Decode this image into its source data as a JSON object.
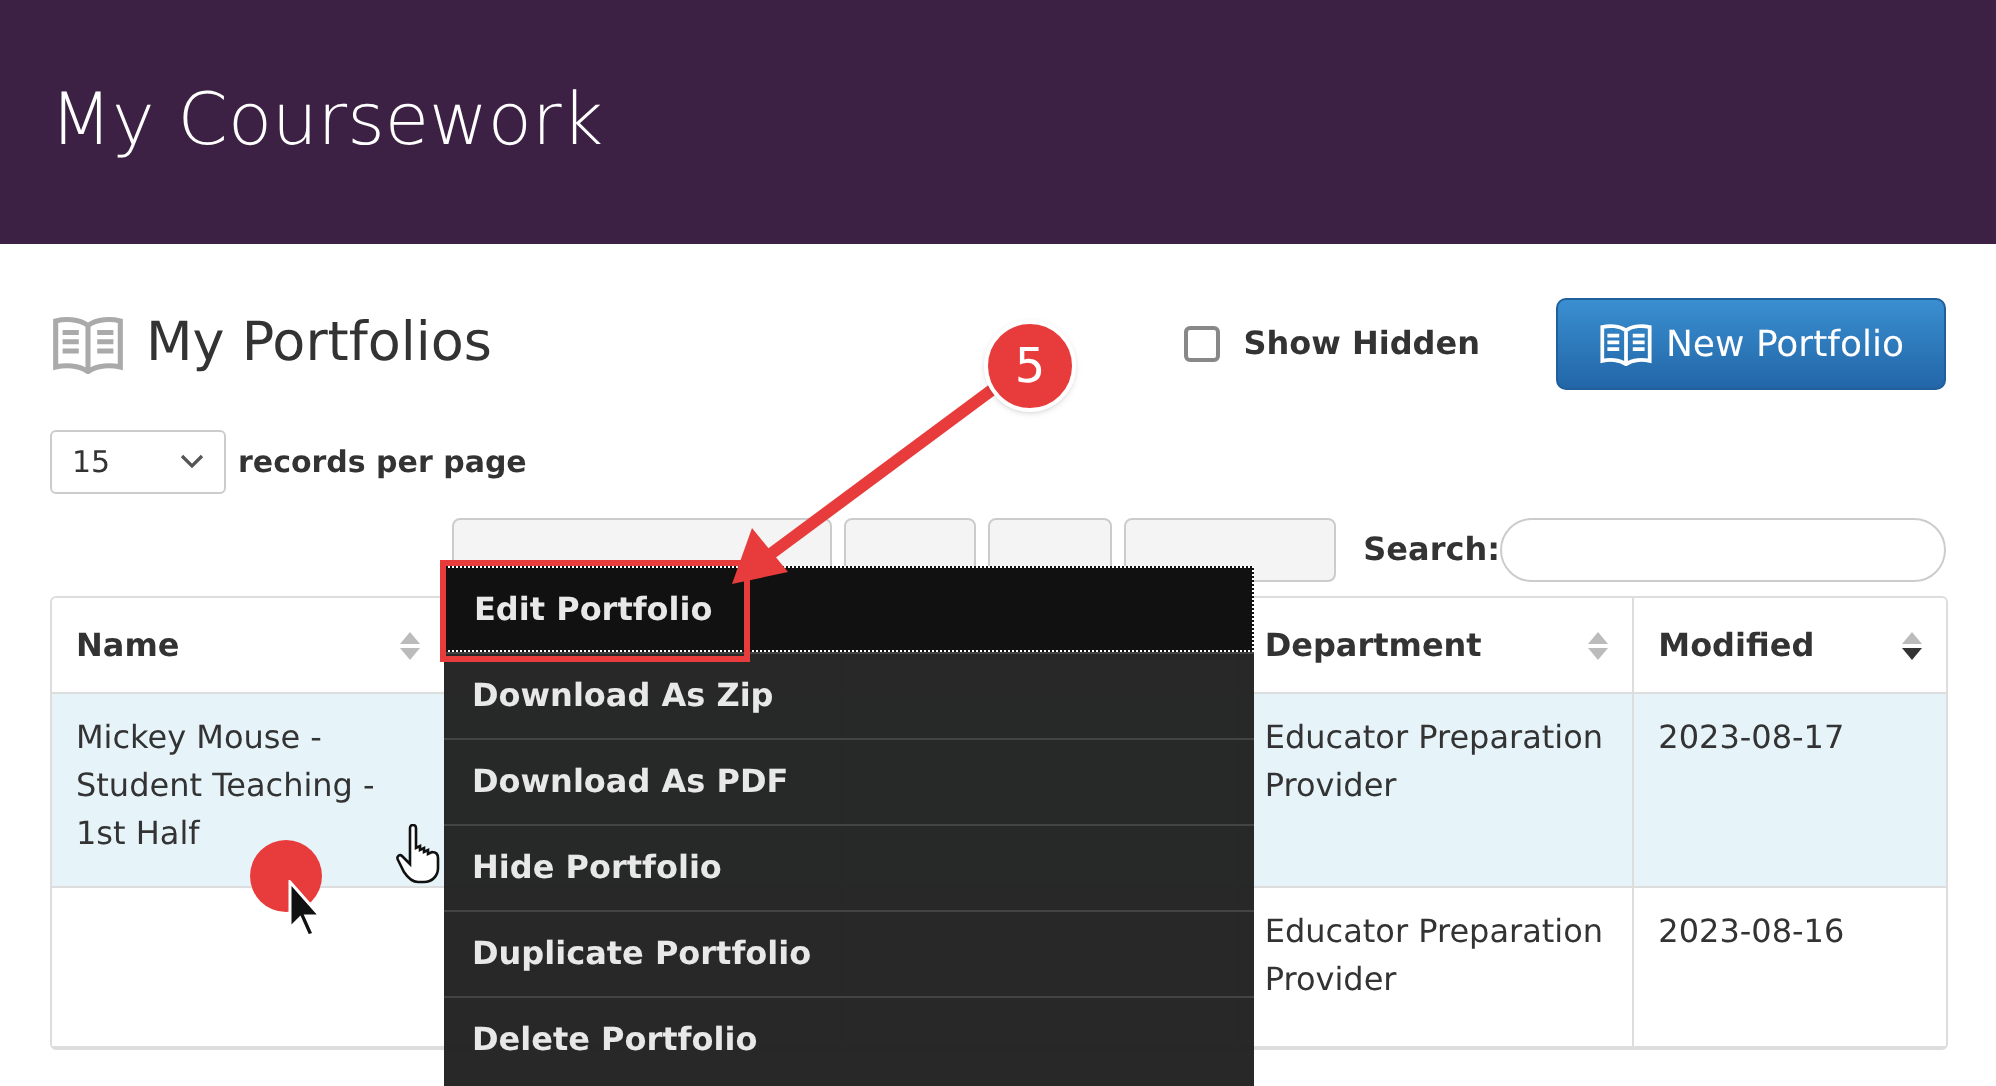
{
  "header": {
    "title": "My Coursework"
  },
  "page": {
    "title": "My Portfolios",
    "show_hidden": {
      "label": "Show Hidden",
      "checked": false
    },
    "new_button": "New Portfolio"
  },
  "paging": {
    "value": "15",
    "label": "records per page"
  },
  "search": {
    "label": "Search:"
  },
  "table": {
    "columns": [
      {
        "label": "Name",
        "sorted_desc": false
      },
      {
        "label": "Department",
        "sorted_desc": false
      },
      {
        "label": "Modified",
        "sorted_desc": true
      }
    ],
    "rows": [
      {
        "name": "Mickey Mouse - Student Teaching - 1st Half",
        "department": "Educator Preparation Provider",
        "modified": "2023-08-17",
        "selected": true
      },
      {
        "department": "Educator Preparation Provider",
        "modified": "2023-08-16",
        "selected": false
      }
    ]
  },
  "menu": {
    "items": [
      {
        "label": "Edit Portfolio",
        "selected": true
      },
      {
        "label": "Download As Zip",
        "selected": false
      },
      {
        "label": "Download As PDF",
        "selected": false
      },
      {
        "label": "Hide Portfolio",
        "selected": false
      },
      {
        "label": "Duplicate Portfolio",
        "selected": false
      },
      {
        "label": "Delete Portfolio",
        "selected": false
      }
    ]
  },
  "callout": {
    "number": "5"
  }
}
